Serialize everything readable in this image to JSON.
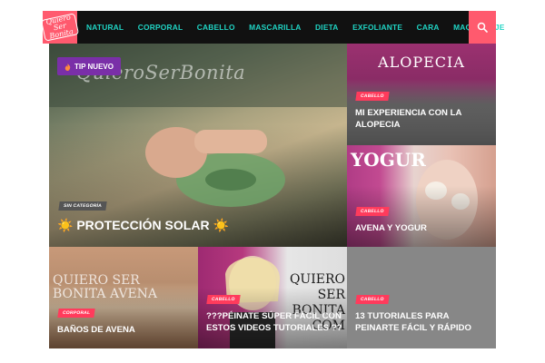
{
  "header": {
    "logo_text": "Quiero Ser Bonita",
    "nav": [
      "NATURAL",
      "CORPORAL",
      "CABELLO",
      "MASCARILLA",
      "DIETA",
      "EXFOLIANTE",
      "CARA",
      "MAQUILLAJE"
    ],
    "search_icon": "search-icon"
  },
  "colors": {
    "accent": "#ff5a6e",
    "nav_text": "#20d4c4",
    "header_bg": "#111111",
    "badge": "#ff3b5c",
    "tip_badge": "#7a2fa8"
  },
  "hero": {
    "tip_label": "TIP NUEVO",
    "watermark": "QuieroSerBonita",
    "category": "SIN CATEGORÍA",
    "title": "☀️ PROTECCIÓN SOLAR ☀️"
  },
  "posts": [
    {
      "watermark": "ALOPECIA",
      "category": "CABELLO",
      "title": "MI EXPERIENCIA CON LA ALOPECIA"
    },
    {
      "watermark": "YOGUR",
      "category": "CABELLO",
      "title": "AVENA Y YOGUR"
    },
    {
      "watermark": "QUIERO SER BONITA AVENA",
      "category": "CORPORAL",
      "title": "BAÑOS DE AVENA"
    },
    {
      "watermark": "QUIERO SER BONITA COM",
      "category": "CABELLO",
      "title": "???PÉINATE SÚPER FÁCIL CON ESTOS VIDEOS TUTORIALES ??"
    },
    {
      "category": "CABELLO",
      "title": "13 TUTORIALES PARA PEINARTE FÁCIL Y RÁPIDO"
    }
  ]
}
